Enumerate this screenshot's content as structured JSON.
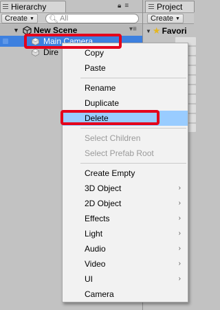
{
  "hierarchy": {
    "tab_label": "Hierarchy",
    "create_label": "Create",
    "search_placeholder": "All",
    "scene_name": "New Scene",
    "objects": [
      {
        "label": "Main Camera",
        "selected": true
      },
      {
        "label": "Dire",
        "selected": false
      }
    ]
  },
  "project": {
    "tab_label": "Project",
    "create_label": "Create",
    "favorites_label": "Favori"
  },
  "menu": {
    "group1": [
      "Copy",
      "Paste"
    ],
    "group2": [
      "Rename",
      "Duplicate",
      "Delete"
    ],
    "group3": [
      "Select Children",
      "Select Prefab Root"
    ],
    "group4": [
      "Create Empty",
      "3D Object",
      "2D Object",
      "Effects",
      "Light",
      "Audio",
      "Video",
      "UI",
      "Camera"
    ],
    "highlighted": "Delete",
    "submenu_arrow": "›"
  },
  "colors": {
    "selection": "#3d80df",
    "menu_highlight": "#99ccff",
    "annotation": "#e4001b"
  },
  "icons": {
    "lock": "lock-icon",
    "tab_menu": "tab-menu-icon",
    "search": "search-icon",
    "scene": "unity-scene-icon",
    "cube": "gameobject-cube-icon",
    "star": "favorites-star-icon"
  }
}
